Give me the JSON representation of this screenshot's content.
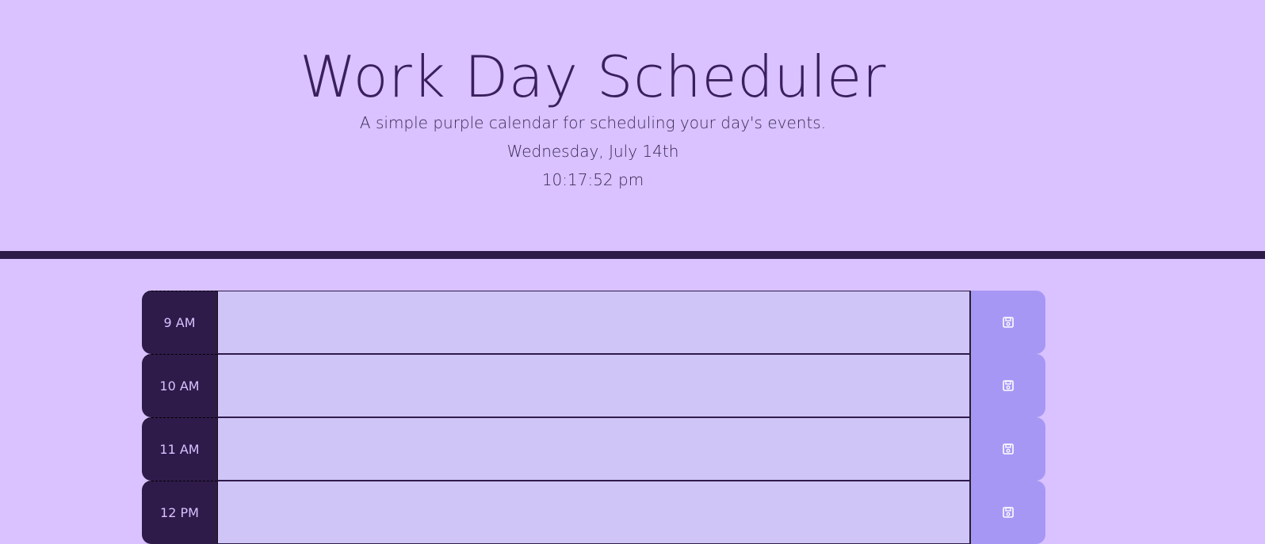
{
  "header": {
    "title": "Work Day Scheduler",
    "subtitle": "A simple purple calendar for scheduling your day's events.",
    "date": "Wednesday, July 14th",
    "time": "10:17:52 pm"
  },
  "schedule": {
    "rows": [
      {
        "hour": "9 AM",
        "description": "",
        "save_icon": "save-icon"
      },
      {
        "hour": "10 AM",
        "description": "",
        "save_icon": "save-icon"
      },
      {
        "hour": "11 AM",
        "description": "",
        "save_icon": "save-icon"
      },
      {
        "hour": "12 PM",
        "description": "",
        "save_icon": "save-icon"
      }
    ]
  },
  "colors": {
    "background": "#d9c2ff",
    "hour_block": "#2f1b4a",
    "textarea": "#cfc5f7",
    "save_button": "#a797f5",
    "divider": "#2f1b4a"
  }
}
